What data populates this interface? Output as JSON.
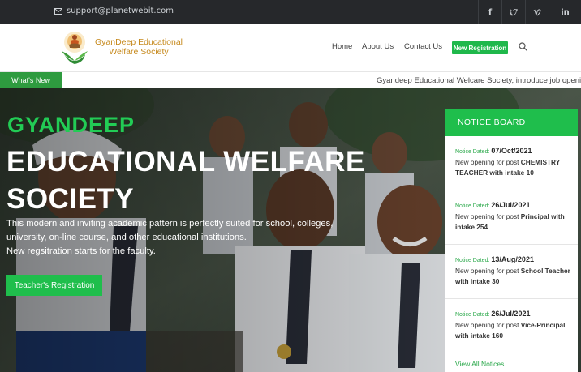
{
  "topbar": {
    "email": "support@planetwebit.com",
    "socials": [
      {
        "icon": "facebook-icon",
        "glyph": "f"
      },
      {
        "icon": "twitter-icon",
        "glyph": "🐦"
      },
      {
        "icon": "vimeo-icon",
        "glyph": "v"
      },
      {
        "icon": "linkedin-icon",
        "glyph": "in"
      }
    ]
  },
  "header": {
    "logo_line1": "GyanDeep Educational",
    "logo_line2": "Welfare Society",
    "nav": {
      "home": "Home",
      "about": "About Us",
      "contact": "Contact Us",
      "register": "New Registration"
    }
  },
  "newsbar": {
    "label": "What's New",
    "ticker": "Gyandeep Educational Welcare Society, introduce job opening"
  },
  "hero": {
    "title_small": "GYANDEEP",
    "title_big": "EDUCATIONAL WELFARE SOCIETY",
    "desc_line1": "This modern and inviting academic pattern is perfectly suited for school, colleges,",
    "desc_line2": "university, on-line course, and other educational institutions.",
    "desc_line3": "New regsitration starts for the faculty.",
    "button": "Teacher's Registration"
  },
  "notice_board": {
    "title": "NOTICE BOARD",
    "date_label": "Notice Dated:",
    "items": [
      {
        "date": "07/Oct/2021",
        "prefix": "New opening for post ",
        "post": "CHEMISTRY TEACHER with intake 10"
      },
      {
        "date": "26/Jul/2021",
        "prefix": "New opening for post ",
        "post": "Principal with intake 254"
      },
      {
        "date": "13/Aug/2021",
        "prefix": "New opening for post ",
        "post": "School Teacher with intake 30"
      },
      {
        "date": "26/Jul/2021",
        "prefix": "New opening for post ",
        "post": "Vice-Principal with intake 160"
      }
    ],
    "view_all": "View All Notices"
  },
  "colors": {
    "accent_green": "#1fbe4c",
    "whats_new_green": "#2e9b3f",
    "topbar_bg": "#26282b",
    "logo_gold": "#c6891c"
  }
}
